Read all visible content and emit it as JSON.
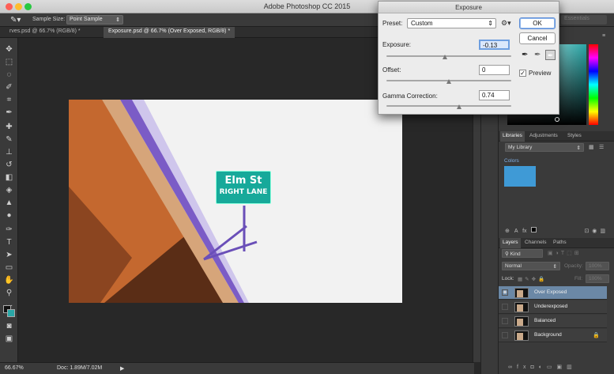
{
  "window": {
    "title": "Adobe Photoshop CC 2015"
  },
  "options_bar": {
    "sample_size_label": "Sample Size:",
    "sample_size_value": "Point Sample",
    "workspace_value": "Essentials"
  },
  "tabs": [
    {
      "label": "rves.psd @ 66.7% (RGB/8) *"
    },
    {
      "label": "Exposure.psd @ 66.7% (Over Exposed, RGB/8) *"
    }
  ],
  "canvas": {
    "sign_line1": "Elm St",
    "sign_line2": "RIGHT LANE"
  },
  "status": {
    "zoom": "66.67%",
    "doc": "Doc: 1.89M/7.02M"
  },
  "dialog": {
    "title": "Exposure",
    "preset_label": "Preset:",
    "preset_value": "Custom",
    "exposure_label": "Exposure:",
    "exposure_value": "-0.13",
    "offset_label": "Offset:",
    "offset_value": "0",
    "gamma_label": "Gamma Correction:",
    "gamma_value": "0.74",
    "ok_label": "OK",
    "cancel_label": "Cancel",
    "preview_label": "Preview",
    "preview_checked": true,
    "exposure_slider": 0.47,
    "offset_slider": 0.5,
    "gamma_slider": 0.58
  },
  "panels": {
    "libraries_tabs": [
      "Libraries",
      "Adjustments",
      "Styles"
    ],
    "library_select": "My Library",
    "colors_label": "Colors",
    "swatch_color": "#3f9ad6",
    "layers_tabs": [
      "Layers",
      "Channels",
      "Paths"
    ],
    "kind_filter": "Kind",
    "blend_mode": "Normal",
    "opacity_label": "Opacity:",
    "opacity_value": "100%",
    "lock_label": "Lock:",
    "fill_label": "Fill:",
    "fill_value": "100%",
    "layers": [
      {
        "name": "Over Exposed",
        "selected": true,
        "visible": true
      },
      {
        "name": "Underexposed",
        "selected": false,
        "visible": false
      },
      {
        "name": "Balanced",
        "selected": false,
        "visible": false
      },
      {
        "name": "Background",
        "selected": false,
        "visible": false,
        "locked": true
      }
    ]
  },
  "colors": {
    "close": "#fe5f57",
    "minimize": "#febc2e",
    "maximize": "#28c840",
    "sign_green": "#17a99a",
    "selection_blue": "#6b88a6"
  }
}
